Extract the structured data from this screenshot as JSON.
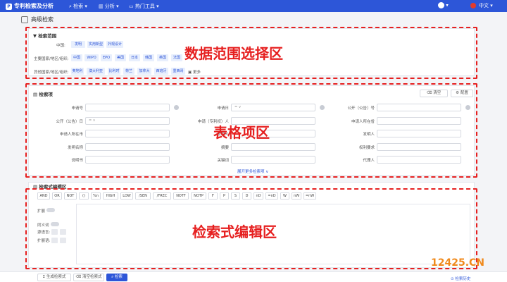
{
  "app": {
    "title": "专利检索及分析",
    "logo": "P"
  },
  "nav": [
    "检索",
    "分析",
    "热门工具"
  ],
  "user": {
    "name": "",
    "language": "中文"
  },
  "page_title": "高级检索",
  "scope": {
    "title": "检索范围",
    "row1_label": "中国:",
    "row1_chips": [
      "发明",
      "实用新型",
      "外观设计"
    ],
    "row2_label": "主要国家/地区/组织:",
    "row2_chips": [
      "中国",
      "WIPO",
      "EPO",
      "美国",
      "日本",
      "韩国",
      "英国",
      "法国"
    ],
    "row3_label": "其他国家/地区/组织:",
    "row3_chips": [
      "奥地利",
      "澳大利亚",
      "比利时",
      "荷兰",
      "加拿大",
      "西班牙",
      "墨西哥"
    ],
    "more": "更多"
  },
  "table": {
    "title": "检索项",
    "clear": "清空",
    "config": "配置",
    "rows": [
      [
        "申请号",
        "申请日",
        "公开（公告）号"
      ],
      [
        "公开（公告）日",
        "申请（专利权）人",
        "申请人所在省"
      ],
      [
        "申请人所在市",
        "发明人",
        "发明人"
      ],
      [
        "发明名称",
        "摘要",
        "权利要求"
      ],
      [
        "说明书",
        "关键词",
        "代理人"
      ]
    ],
    "date_placeholder": "= ∨",
    "expand": "展开更多检索项 ∨"
  },
  "editor": {
    "title": "检索式编辑区",
    "operators": [
      "AND",
      "OR",
      "NOT",
      "()",
      "%n",
      "HIGH",
      "LOW",
      "/SEN",
      "/FREC",
      "NOTF",
      "NOTP",
      "F",
      "P",
      "S",
      "D",
      "nD",
      "=nD",
      "W",
      "nW",
      "=nW"
    ],
    "expand_label": "扩展",
    "synonym_label": "同义词",
    "source_label": "源语言:",
    "target_label": "扩展语:"
  },
  "annotations": {
    "scope": "数据范围选择区",
    "table": "表格项区",
    "editor": "检索式编辑区"
  },
  "footer": {
    "generate": "生成检索式",
    "clear": "清空检索式",
    "search": "检索",
    "history": "检索历史"
  },
  "watermark": "12425.CN",
  "colors": {
    "brand": "#2d56d8",
    "annotation": "#e62020",
    "watermark_orange": "#f08a1c"
  }
}
